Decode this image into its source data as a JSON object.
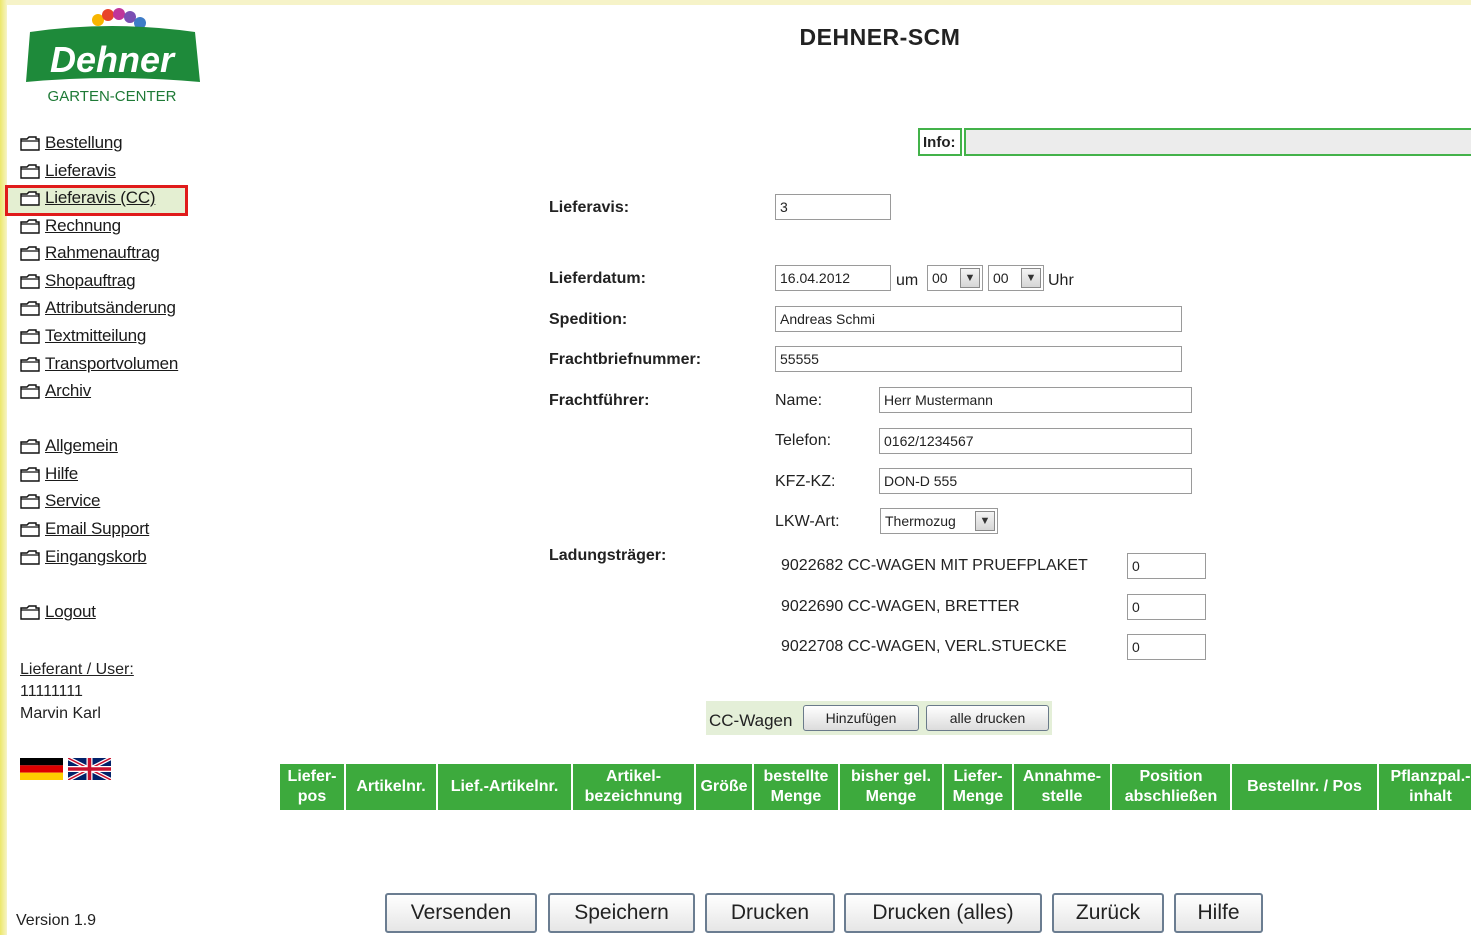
{
  "app_title": "DEHNER-SCM",
  "logo": {
    "brand": "Dehner",
    "subtitle": "GARTEN-CENTER"
  },
  "sidebar": {
    "items": [
      {
        "label": "Bestellung"
      },
      {
        "label": "Lieferavis"
      },
      {
        "label": "Lieferavis (CC)",
        "selected": true
      },
      {
        "label": "Rechnung"
      },
      {
        "label": "Rahmenauftrag"
      },
      {
        "label": "Shopauftrag"
      },
      {
        "label": "Attributsänderung"
      },
      {
        "label": "Textmitteilung"
      },
      {
        "label": "Transportvolumen"
      },
      {
        "label": "Archiv"
      },
      {
        "label": "Allgemein"
      },
      {
        "label": "Hilfe"
      },
      {
        "label": "Service"
      },
      {
        "label": "Email Support"
      },
      {
        "label": "Eingangskorb"
      },
      {
        "label": "Logout"
      }
    ],
    "user_label": "Lieferant / User:",
    "user_id": "11111111",
    "user_name": "Marvin Karl",
    "version": "Version 1.9",
    "languages": [
      "german-flag-icon",
      "uk-flag-icon"
    ]
  },
  "info": {
    "label": "Info:",
    "value": ""
  },
  "form": {
    "lieferavis_label": "Lieferavis:",
    "lieferavis_value": "3",
    "lieferdatum_label": "Lieferdatum:",
    "lieferdatum_value": "16.04.2012",
    "um_label": "um",
    "hour_value": "00",
    "minute_value": "00",
    "uhr_label": "Uhr",
    "spedition_label": "Spedition:",
    "spedition_value": "Andreas Schmi",
    "frachtbrief_label": "Frachtbriefnummer:",
    "frachtbrief_value": "55555",
    "frachtfuehrer_label": "Frachtführer:",
    "name_label": "Name:",
    "name_value": "Herr Mustermann",
    "telefon_label": "Telefon:",
    "telefon_value": "0162/1234567",
    "kfz_label": "KFZ-KZ:",
    "kfz_value": "DON-D 555",
    "lkw_label": "LKW-Art:",
    "lkw_value": "Thermozug",
    "ladung_label": "Ladungsträger:",
    "ladung_items": [
      {
        "label": "9022682 CC-WAGEN MIT PRUEFPLAKET",
        "value": "0"
      },
      {
        "label": "9022690 CC-WAGEN, BRETTER",
        "value": "0"
      },
      {
        "label": "9022708 CC-WAGEN, VERL.STUECKE",
        "value": "0"
      }
    ]
  },
  "cc_wagen": {
    "label": "CC-Wagen",
    "add_button": "Hinzufügen",
    "print_all_button": "alle drucken"
  },
  "table_headers": [
    [
      "Liefer-",
      "pos"
    ],
    [
      "Artikelnr."
    ],
    [
      "Lief.-Artikelnr."
    ],
    [
      "Artikel-",
      "bezeichnung"
    ],
    [
      "Größe"
    ],
    [
      "bestellte",
      "Menge"
    ],
    [
      "bisher gel.",
      "Menge"
    ],
    [
      "Liefer-",
      "Menge"
    ],
    [
      "Annahme-",
      "stelle"
    ],
    [
      "Position",
      "abschließen"
    ],
    [
      "Bestellnr. / Pos"
    ],
    [
      "Pflanzpal.-",
      "inhalt"
    ]
  ],
  "actions": [
    "Versenden",
    "Speichern",
    "Drucken",
    "Drucken (alles)",
    "Zurück",
    "Hilfe"
  ],
  "colors": {
    "header_green": "#3daa3d",
    "brand_green": "#1e8a3a",
    "highlight_red": "#e01b1b"
  }
}
